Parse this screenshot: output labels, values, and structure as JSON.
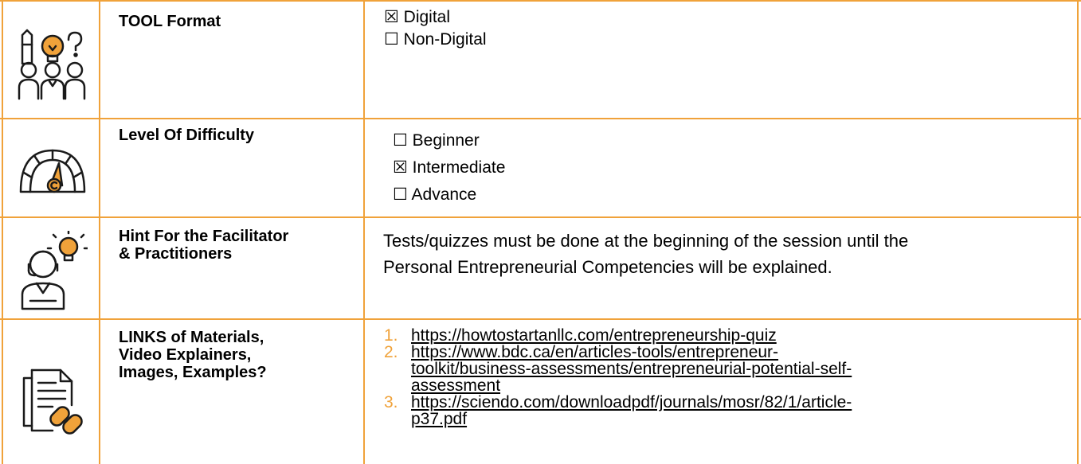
{
  "rows": [
    {
      "icon": "people-lightbulb-question-icon",
      "label": "TOOL Format",
      "options": [
        {
          "mark": "☒",
          "text": "Digital"
        },
        {
          "mark": "☐",
          "text": "Non-Digital"
        }
      ]
    },
    {
      "icon": "difficulty-gauge-icon",
      "label": "Level Of Difficulty",
      "options": [
        {
          "mark": "☐",
          "text": "Beginner"
        },
        {
          "mark": "☒",
          "text": "Intermediate"
        },
        {
          "mark": "☐",
          "text": "Advance"
        }
      ]
    },
    {
      "icon": "facilitator-idea-icon",
      "label_line1": "Hint For the Facilitator",
      "label_line2": "& Practitioners",
      "hint_line1": "Tests/quizzes must be done at the beginning of the session until the",
      "hint_line2": "Personal Entrepreneurial Competencies will be explained."
    },
    {
      "icon": "document-link-icon",
      "label_line1": "LINKS of Materials,",
      "label_line2": "Video Explainers,",
      "label_line3": "Images, Examples?",
      "links": [
        {
          "num": "1.",
          "lines": [
            "https://howtostartanllc.com/entrepreneurship-quiz"
          ]
        },
        {
          "num": "2.",
          "lines": [
            "https://www.bdc.ca/en/articles-tools/entrepreneur-",
            "toolkit/business-assessments/entrepreneurial-potential-self-",
            "assessment"
          ]
        },
        {
          "num": "3.",
          "lines": [
            "https://sciendo.com/downloadpdf/journals/mosr/82/1/article-",
            "p37.pdf"
          ]
        }
      ]
    }
  ],
  "colors": {
    "border": "#f0a23a",
    "icon_line": "#1a1a1a",
    "icon_accent": "#f0a23a"
  }
}
